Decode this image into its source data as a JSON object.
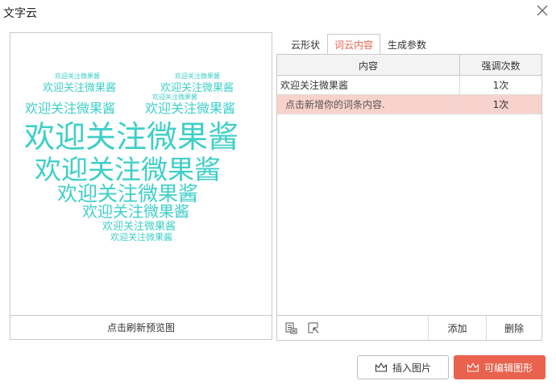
{
  "window": {
    "title": "文字云"
  },
  "preview": {
    "words": [
      {
        "text": "欢迎关注微果酱",
        "size": 8
      },
      {
        "text": "欢迎关注微果酱",
        "size": 8
      },
      {
        "text": "欢迎关注微果酱",
        "size": 13
      },
      {
        "text": "欢迎关注微果酱",
        "size": 13
      },
      {
        "text": "欢迎关注微果酱",
        "size": 8
      },
      {
        "text": "欢迎关注微果酱",
        "size": 16
      },
      {
        "text": "欢迎关注微果酱",
        "size": 16
      },
      {
        "text": "欢迎关注微果酱",
        "size": 38
      },
      {
        "text": "欢迎关注微果酱",
        "size": 33
      },
      {
        "text": "欢迎关注微果酱",
        "size": 25
      },
      {
        "text": "欢迎关注微果酱",
        "size": 19
      },
      {
        "text": "欢迎关注微果酱",
        "size": 13
      },
      {
        "text": "欢迎关注微果酱",
        "size": 11
      }
    ],
    "refresh_label": "点击刷新预览图",
    "word_color": "#3ecfc8"
  },
  "tabs": [
    {
      "label": "云形状",
      "active": false
    },
    {
      "label": "词云内容",
      "active": true
    },
    {
      "label": "生成参数",
      "active": false
    }
  ],
  "table": {
    "headers": [
      "内容",
      "强调次数"
    ],
    "rows": [
      {
        "content": "欢迎关注微果酱",
        "count": "1次"
      },
      {
        "content": "点击新增你的词条内容.",
        "count": "1次"
      }
    ]
  },
  "bottombar": {
    "icons": [
      "import-excel-icon",
      "export-icon"
    ],
    "add_label": "添加",
    "delete_label": "删除"
  },
  "buttons": {
    "insert_label": "插入图片",
    "edit_label": "可编辑图形"
  },
  "colors": {
    "accent": "#e8624d",
    "selected_row": "#f8d2cc",
    "word": "#3ecfc8"
  }
}
